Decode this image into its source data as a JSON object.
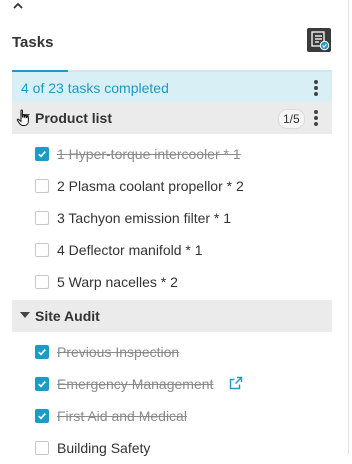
{
  "panel": {
    "title": "Tasks",
    "summary": "4 of 23 tasks completed"
  },
  "groups": [
    {
      "label": "Product list",
      "badge": "1/5",
      "items": [
        {
          "label": "1 Hyper-torque intercooler * 1",
          "done": true
        },
        {
          "label": "2 Plasma coolant propellor * 2",
          "done": false
        },
        {
          "label": "3 Tachyon emission filter * 1",
          "done": false
        },
        {
          "label": "4 Deflector manifold * 1",
          "done": false
        },
        {
          "label": "5 Warp nacelles * 2",
          "done": false
        }
      ]
    },
    {
      "label": "Site Audit",
      "items": [
        {
          "label": "Previous Inspection",
          "done": true
        },
        {
          "label": "Emergency Management",
          "done": true,
          "external_link_icon": "external-link-icon"
        },
        {
          "label": "First Aid and Medical",
          "done": true
        },
        {
          "label": "Building Safety",
          "done": false
        }
      ]
    }
  ],
  "colors": {
    "accent": "#1b9bc6",
    "summary_bg": "#d9eff6",
    "group_bg": "#ebebeb"
  }
}
